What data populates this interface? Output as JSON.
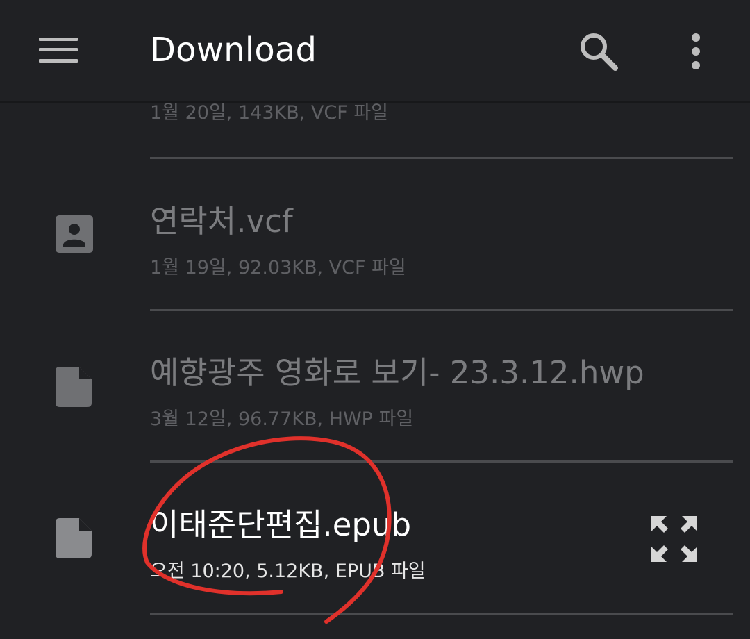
{
  "appbar": {
    "title": "Download",
    "menu_icon": "hamburger-menu-icon",
    "search_icon": "search-icon",
    "more_icon": "more-vert-icon"
  },
  "files": [
    {
      "name": "",
      "meta": "1월 20일, 143KB, VCF 파일",
      "icon": "contact-file-icon"
    },
    {
      "name": "연락처.vcf",
      "meta": "1월 19일, 92.03KB, VCF 파일",
      "icon": "contact-file-icon"
    },
    {
      "name": "예향광주 영화로 보기- 23.3.12.hwp",
      "meta": "3월 12일, 96.77KB, HWP 파일",
      "icon": "document-file-icon"
    },
    {
      "name": "이태준단편집.epub",
      "meta": "오전 10:20, 5.12KB, EPUB 파일",
      "icon": "document-file-icon",
      "action_icon": "expand-icon"
    }
  ],
  "colors": {
    "background": "#202124",
    "divider": "#4a4b4e",
    "dim_text": "#7b7c7f",
    "annotation": "#e0312b"
  }
}
